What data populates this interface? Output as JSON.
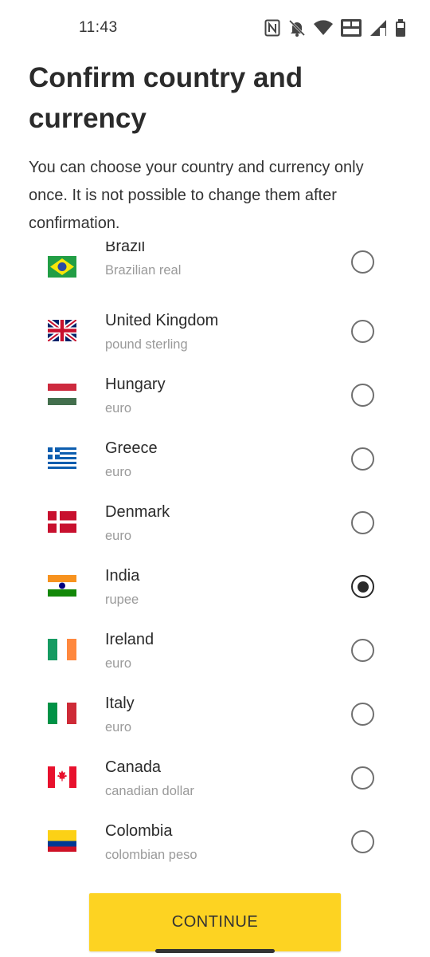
{
  "status_bar": {
    "time": "11:43",
    "icons": [
      "nfc-icon",
      "bell-muted-icon",
      "wifi-icon",
      "vowifi-icon",
      "signal-icon",
      "battery-icon"
    ]
  },
  "header": {
    "title": "Confirm country and currency",
    "subtitle": "You can choose your country and currency only once. It is not possible to change them after confirmation."
  },
  "countries": [
    {
      "name": "Brazil",
      "currency": "Brazilian real",
      "flag": "brazil-flag",
      "selected": false
    },
    {
      "name": "United Kingdom",
      "currency": "pound sterling",
      "flag": "uk-flag",
      "selected": false
    },
    {
      "name": "Hungary",
      "currency": "euro",
      "flag": "hungary-flag",
      "selected": false
    },
    {
      "name": "Greece",
      "currency": "euro",
      "flag": "greece-flag",
      "selected": false
    },
    {
      "name": "Denmark",
      "currency": "euro",
      "flag": "denmark-flag",
      "selected": false
    },
    {
      "name": "India",
      "currency": "rupee",
      "flag": "india-flag",
      "selected": true
    },
    {
      "name": "Ireland",
      "currency": "euro",
      "flag": "ireland-flag",
      "selected": false
    },
    {
      "name": "Italy",
      "currency": "euro",
      "flag": "italy-flag",
      "selected": false
    },
    {
      "name": "Canada",
      "currency": "canadian dollar",
      "flag": "canada-flag",
      "selected": false
    },
    {
      "name": "Colombia",
      "currency": "colombian peso",
      "flag": "colombia-flag",
      "selected": false
    }
  ],
  "footer": {
    "continue_label": "CONTINUE"
  },
  "colors": {
    "accent": "#fdd322",
    "radio_border": "#707070",
    "radio_selected": "#2a2a2a"
  }
}
